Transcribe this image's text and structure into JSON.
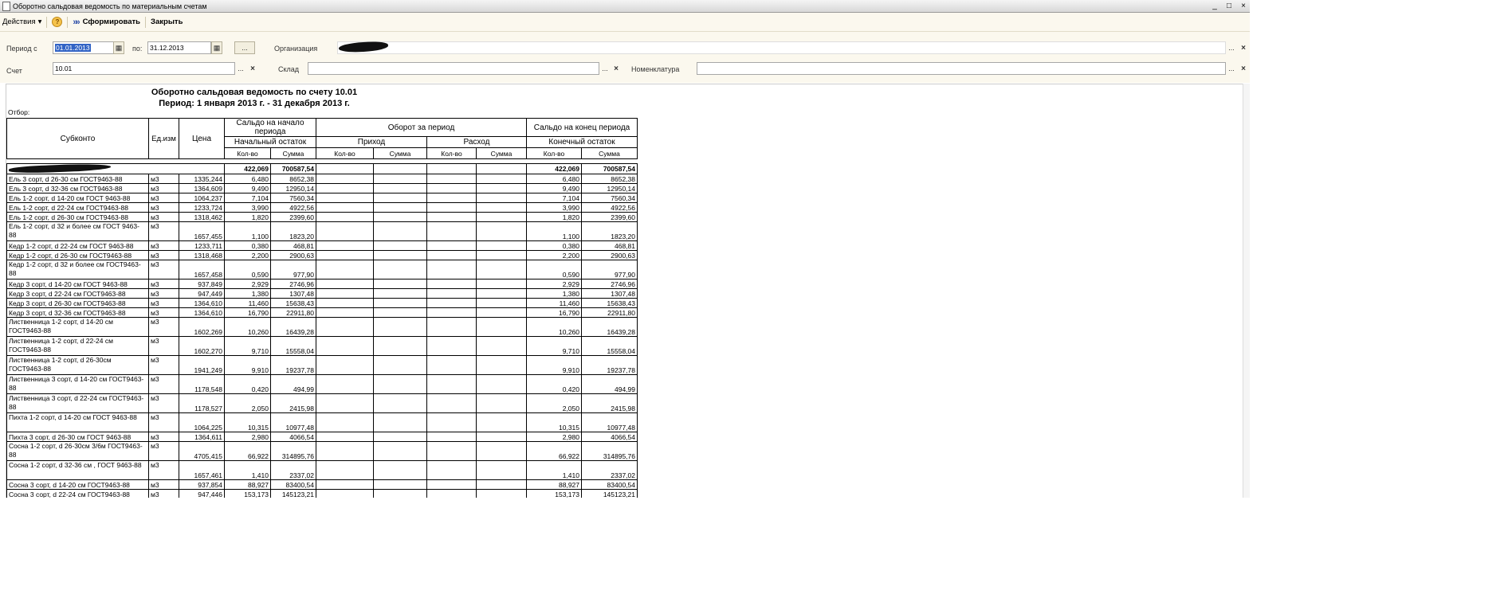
{
  "window": {
    "title": "Оборотно сальдовая ведомость по материальным счетам",
    "min": "_",
    "max": "□",
    "close": "×"
  },
  "toolbar": {
    "actions": "Действия",
    "help": "?",
    "generate": "Сформировать",
    "close": "Закрыть"
  },
  "form": {
    "period_label": "Период с",
    "period_from": "01.01.2013",
    "to_label": "по:",
    "period_to": "31.12.2013",
    "dots": "...",
    "clear": "×",
    "org_label": "Организация",
    "org_value": "",
    "account_label": "Счет",
    "account_value": "10.01",
    "warehouse_label": "Склад",
    "warehouse_value": "",
    "nomen_label": "Номенклатура",
    "nomen_value": ""
  },
  "report": {
    "title": "Оборотно сальдовая ведомость по счету 10.01",
    "period": "Период: 1 января 2013 г. - 31 декабря 2013 г.",
    "filter_label": "Отбор:",
    "headers": {
      "subkonto": "Субконто",
      "unit": "Ед.изм",
      "price": "Цена",
      "start": "Сальдо на начало периода",
      "turnover": "Оборот за период",
      "end": "Сальдо на конец периода",
      "start_sub": "Начальный остаток",
      "income": "Приход",
      "expense": "Расход",
      "end_sub": "Конечный остаток",
      "qty": "Кол-во",
      "sum": "Сумма"
    },
    "group": {
      "start_qty": "422,069",
      "start_sum": "700587,54",
      "end_qty": "422,069",
      "end_sum": "700587,54"
    },
    "rows": [
      {
        "name": "Ель  3 сорт, d 26-30 см ГОСТ9463-88",
        "unit": "м3",
        "price": "1335,244",
        "q": "6,480",
        "s": "8652,38",
        "eq": "6,480",
        "es": "8652,38"
      },
      {
        "name": "Ель  3 сорт, d 32-36 см  ГОСТ9463-88",
        "unit": "м3",
        "price": "1364,609",
        "q": "9,490",
        "s": "12950,14",
        "eq": "9,490",
        "es": "12950,14"
      },
      {
        "name": "Ель 1-2 сорт, d 14-20 см ГОСТ 9463-88",
        "unit": "м3",
        "price": "1064,237",
        "q": "7,104",
        "s": "7560,34",
        "eq": "7,104",
        "es": "7560,34"
      },
      {
        "name": "Ель 1-2 сорт, d 22-24 см ГОСТ9463-88",
        "unit": "м3",
        "price": "1233,724",
        "q": "3,990",
        "s": "4922,56",
        "eq": "3,990",
        "es": "4922,56"
      },
      {
        "name": "Ель 1-2 сорт, d 26-30 см ГОСТ9463-88",
        "unit": "м3",
        "price": "1318,462",
        "q": "1,820",
        "s": "2399,60",
        "eq": "1,820",
        "es": "2399,60"
      },
      {
        "name": "Ель 1-2 сорт, d 32 и более см ГОСТ 9463-88",
        "unit": "м3",
        "price": "1657,455",
        "q": "1,100",
        "s": "1823,20",
        "eq": "1,100",
        "es": "1823,20"
      },
      {
        "name": "Кедр 1-2 сорт, d 22-24 см ГОСТ 9463-88",
        "unit": "м3",
        "price": "1233,711",
        "q": "0,380",
        "s": "468,81",
        "eq": "0,380",
        "es": "468,81"
      },
      {
        "name": "Кедр 1-2 сорт, d 26-30 см ГОСТ9463-88",
        "unit": "м3",
        "price": "1318,468",
        "q": "2,200",
        "s": "2900,63",
        "eq": "2,200",
        "es": "2900,63"
      },
      {
        "name": "Кедр 1-2 сорт, d 32 и более см ГОСТ9463-88",
        "unit": "м3",
        "price": "1657,458",
        "q": "0,590",
        "s": "977,90",
        "eq": "0,590",
        "es": "977,90"
      },
      {
        "name": "Кедр 3 сорт, d 14-20 см ГОСТ 9463-88",
        "unit": "м3",
        "price": "937,849",
        "q": "2,929",
        "s": "2746,96",
        "eq": "2,929",
        "es": "2746,96"
      },
      {
        "name": "Кедр 3 сорт, d 22-24 см ГОСТ9463-88",
        "unit": "м3",
        "price": "947,449",
        "q": "1,380",
        "s": "1307,48",
        "eq": "1,380",
        "es": "1307,48"
      },
      {
        "name": "Кедр 3 сорт, d 26-30 см ГОСТ9463-88",
        "unit": "м3",
        "price": "1364,610",
        "q": "11,460",
        "s": "15638,43",
        "eq": "11,460",
        "es": "15638,43"
      },
      {
        "name": "Кедр 3 сорт, d 32-36 см ГОСТ9463-88",
        "unit": "м3",
        "price": "1364,610",
        "q": "16,790",
        "s": "22911,80",
        "eq": "16,790",
        "es": "22911,80"
      },
      {
        "name": "Лиственница 1-2 сорт, d 14-20 см ГОСТ9463-88",
        "unit": "м3",
        "price": "1602,269",
        "q": "10,260",
        "s": "16439,28",
        "eq": "10,260",
        "es": "16439,28"
      },
      {
        "name": "Лиственница 1-2 сорт, d 22-24 см ГОСТ9463-88",
        "unit": "м3",
        "price": "1602,270",
        "q": "9,710",
        "s": "15558,04",
        "eq": "9,710",
        "es": "15558,04"
      },
      {
        "name": "Лиственница 1-2 сорт, d 26-30см ГОСТ9463-88",
        "unit": "м3",
        "price": "1941,249",
        "q": "9,910",
        "s": "19237,78",
        "eq": "9,910",
        "es": "19237,78"
      },
      {
        "name": "Лиственница 3 сорт, d 14-20 см ГОСТ9463-88",
        "unit": "м3",
        "price": "1178,548",
        "q": "0,420",
        "s": "494,99",
        "eq": "0,420",
        "es": "494,99"
      },
      {
        "name": "Лиственница 3 сорт, d 22-24 см ГОСТ9463-88",
        "unit": "м3",
        "price": "1178,527",
        "q": "2,050",
        "s": "2415,98",
        "eq": "2,050",
        "es": "2415,98"
      },
      {
        "name": "Пихта 1-2 сорт, d 14-20 см ГОСТ 9463-88",
        "unit": "м3",
        "price": "1064,225",
        "q": "10,315",
        "s": "10977,48",
        "eq": "10,315",
        "es": "10977,48"
      },
      {
        "name": "Пихта 3 сорт, d 26-30 см ГОСТ 9463-88",
        "unit": "м3",
        "price": "1364,611",
        "q": "2,980",
        "s": "4066,54",
        "eq": "2,980",
        "es": "4066,54"
      },
      {
        "name": "Сосна 1-2 сорт, d 26-30см 3/6м ГОСТ9463-88",
        "unit": "м3",
        "price": "4705,415",
        "q": "66,922",
        "s": "314895,76",
        "eq": "66,922",
        "es": "314895,76"
      },
      {
        "name": "Сосна 1-2 сорт, d 32-36 см , ГОСТ 9463-88",
        "unit": "м3",
        "price": "1657,461",
        "q": "1,410",
        "s": "2337,02",
        "eq": "1,410",
        "es": "2337,02"
      },
      {
        "name": "Сосна 3 сорт, d 14-20 см ГОСТ9463-88",
        "unit": "м3",
        "price": "937,854",
        "q": "88,927",
        "s": "83400,54",
        "eq": "88,927",
        "es": "83400,54"
      },
      {
        "name": "Сосна 3 сорт, d 22-24 см ГОСТ9463-88",
        "unit": "м3",
        "price": "947,446",
        "q": "153,173",
        "s": "145123,21",
        "eq": "153,173",
        "es": "145123,21"
      }
    ]
  }
}
